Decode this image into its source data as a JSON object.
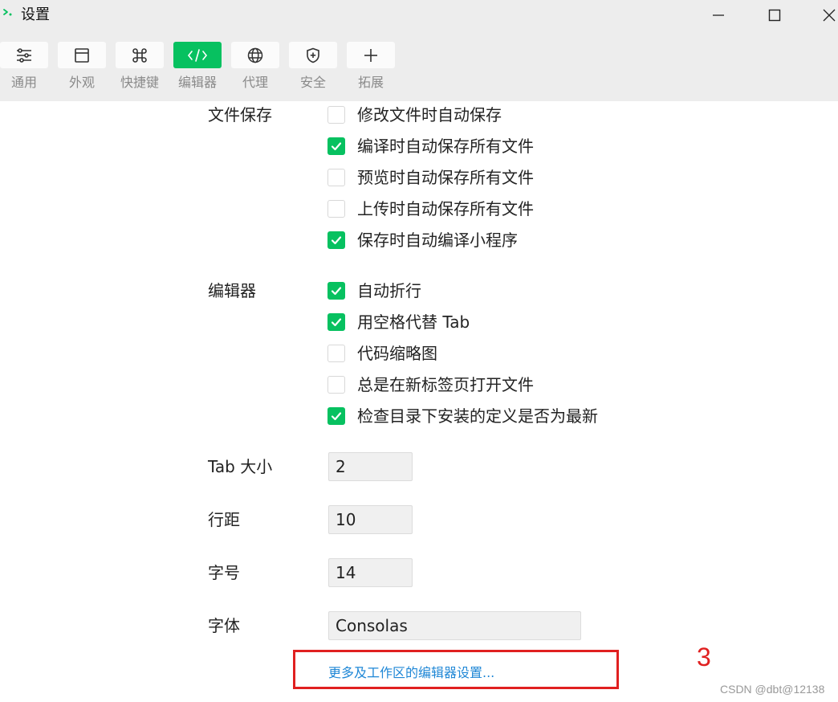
{
  "window": {
    "title": "设置",
    "app_icon": "wechat-devtools-icon",
    "controls": [
      "minimize-icon",
      "maximize-icon",
      "close-icon"
    ]
  },
  "toolbar": {
    "tabs": [
      {
        "label": "通用",
        "icon": "sliders-icon",
        "active": false
      },
      {
        "label": "外观",
        "icon": "window-icon",
        "active": false
      },
      {
        "label": "快捷键",
        "icon": "command-icon",
        "active": false
      },
      {
        "label": "编辑器",
        "icon": "code-icon",
        "active": true
      },
      {
        "label": "代理",
        "icon": "globe-icon",
        "active": false
      },
      {
        "label": "安全",
        "icon": "shield-icon",
        "active": false
      },
      {
        "label": "拓展",
        "icon": "plus-icon",
        "active": false
      }
    ]
  },
  "file_save": {
    "label": "文件保存",
    "options": [
      {
        "label": "修改文件时自动保存",
        "checked": false
      },
      {
        "label": "编译时自动保存所有文件",
        "checked": true
      },
      {
        "label": "预览时自动保存所有文件",
        "checked": false
      },
      {
        "label": "上传时自动保存所有文件",
        "checked": false
      },
      {
        "label": "保存时自动编译小程序",
        "checked": true
      }
    ]
  },
  "editor": {
    "label": "编辑器",
    "options": [
      {
        "label": "自动折行",
        "checked": true
      },
      {
        "label": "用空格代替 Tab",
        "checked": true
      },
      {
        "label": "代码缩略图",
        "checked": false
      },
      {
        "label": "总是在新标签页打开文件",
        "checked": false
      },
      {
        "label": "检查目录下安装的定义是否为最新",
        "checked": true
      }
    ]
  },
  "fields": {
    "tab_size": {
      "label": "Tab 大小",
      "value": "2"
    },
    "line_height": {
      "label": "行距",
      "value": "10"
    },
    "font_size": {
      "label": "字号",
      "value": "14"
    },
    "font_family": {
      "label": "字体",
      "value": "Consolas"
    }
  },
  "more_link": "更多及工作区的编辑器设置...",
  "annotation": {
    "number": "3",
    "color": "#e02020"
  },
  "watermark": "CSDN @dbt@12138",
  "colors": {
    "accent": "#07c160",
    "link": "#1f87d6",
    "chrome": "#ededed"
  }
}
